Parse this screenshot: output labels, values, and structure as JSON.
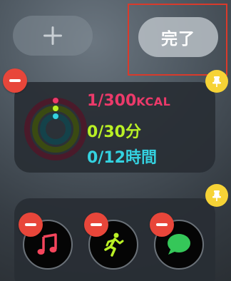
{
  "top_bar": {
    "add_button": {
      "icon": "plus-icon"
    },
    "done_button": {
      "label": "完了"
    }
  },
  "activity_widget": {
    "move": {
      "value": "1/300",
      "unit": "KCAL",
      "color": "#ec3a6a"
    },
    "exercise": {
      "value": "0/30",
      "unit": "分",
      "color": "#b9f025"
    },
    "stand": {
      "value": "0/12",
      "unit": "時間",
      "color": "#34d2e0"
    }
  },
  "apps_widget": {
    "apps": [
      {
        "name": "music",
        "icon": "music-note-icon",
        "color": "#f5455c"
      },
      {
        "name": "workout",
        "icon": "running-figure-icon",
        "color": "#b9f025"
      },
      {
        "name": "messages",
        "icon": "speech-bubble-icon",
        "color": "#35c759"
      }
    ]
  },
  "colors": {
    "remove_badge": "#e8463a",
    "pin_badge": "#f6d336",
    "highlight_box": "#d93a2b"
  }
}
